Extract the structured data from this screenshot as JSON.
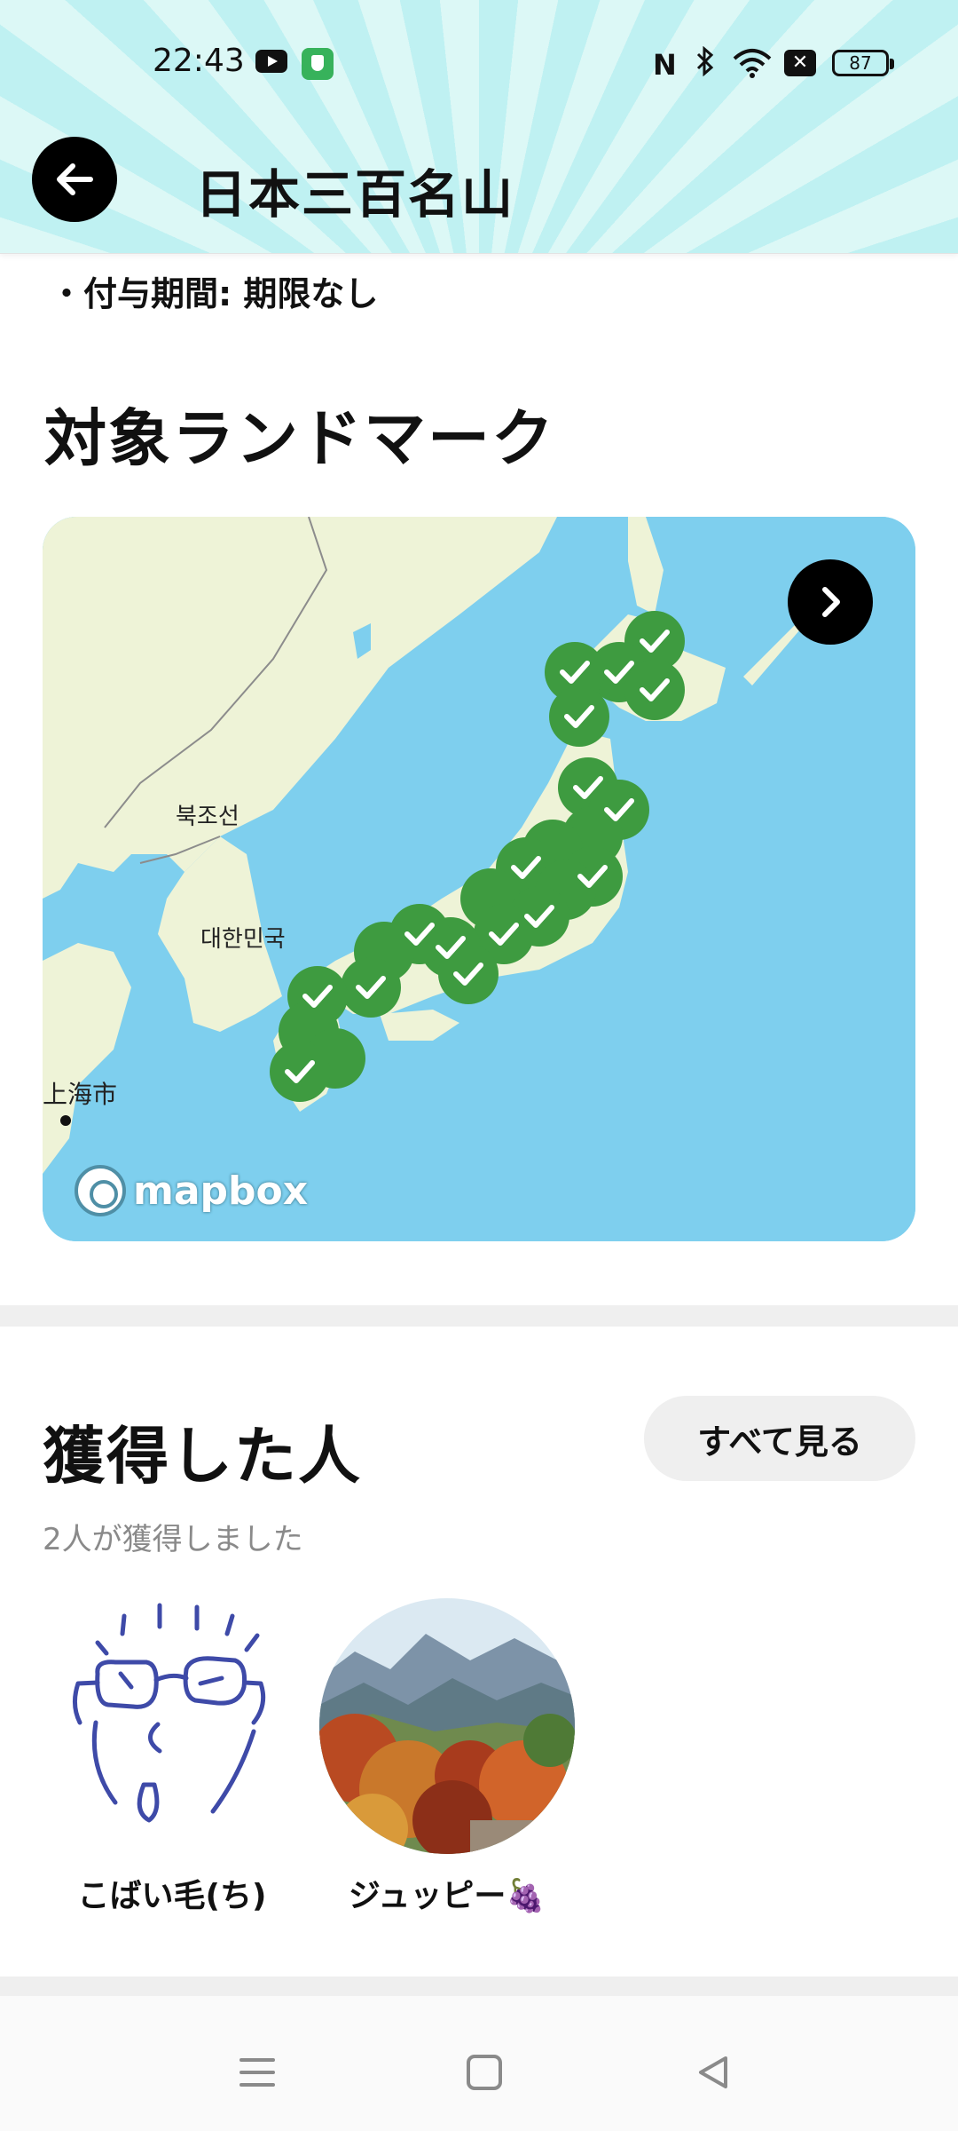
{
  "status_bar": {
    "time": "22:43",
    "icons": [
      "youtube-icon",
      "shield-app-icon",
      "nfc-icon",
      "bluetooth-icon",
      "wifi-icon",
      "x-notification-icon"
    ],
    "battery": "87"
  },
  "header": {
    "back_icon": "arrow-left-icon",
    "title": "日本三百名山"
  },
  "grant_period": "・付与期間: 期限なし",
  "landmarks": {
    "title": "対象ランドマーク",
    "map": {
      "labels": {
        "north_korea": "북조선",
        "south_korea": "대한민국",
        "shanghai": "上海市"
      },
      "attribution": "mapbox",
      "next_icon": "chevron-right-icon",
      "marker_icon": "check-marker-icon",
      "colors": {
        "water": "#7ecfee",
        "land": "#eef3d7",
        "marker": "#3e9b40"
      }
    }
  },
  "acquired": {
    "title": "獲得した人",
    "see_all": "すべて見る",
    "subtitle": "2人が獲得しました",
    "people": [
      {
        "name": "こばい毛(ち)",
        "avatar": "doodle-face-avatar"
      },
      {
        "name": "ジュッピー🍇",
        "avatar": "mountain-photo-avatar"
      }
    ]
  },
  "nav_bar": {
    "icons": [
      "menu-icon",
      "home-square-icon",
      "back-triangle-icon"
    ]
  }
}
